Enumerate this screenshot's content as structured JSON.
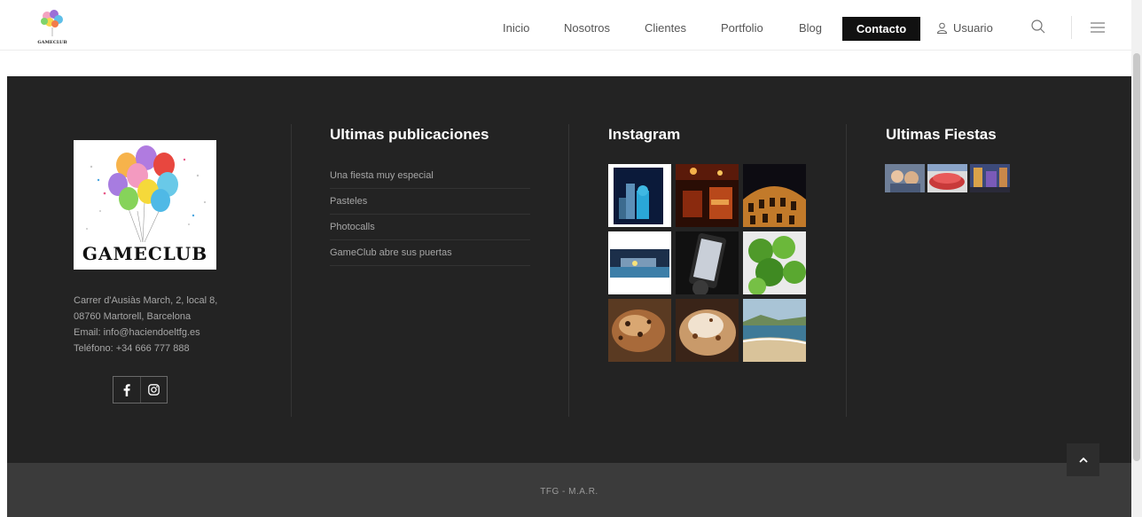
{
  "header": {
    "logo_text": "GAMECLUB",
    "nav": [
      "Inicio",
      "Nosotros",
      "Clientes",
      "Portfolio",
      "Blog"
    ],
    "contact_label": "Contacto",
    "user_label": "Usuario"
  },
  "footer": {
    "logo_text": "GAMECLUB",
    "address": [
      "Carrer d'Ausiàs March, 2, local 8,",
      "08760 Martorell, Barcelona",
      "Email: info@haciendoeltfg.es",
      "Teléfono: +34 666 777 888"
    ],
    "posts_title": "Ultimas publicaciones",
    "posts": [
      "Una fiesta muy especial",
      "Pasteles",
      "Photocalls",
      "GameClub abre sus puertas"
    ],
    "instagram_title": "Instagram",
    "parties_title": "Ultimas Fiestas",
    "copyright": "TFG - M.A.R."
  },
  "colors": {
    "footer_bg": "#232323",
    "bottom_bar_bg": "#3b3b3b",
    "contact_bg": "#111111"
  }
}
